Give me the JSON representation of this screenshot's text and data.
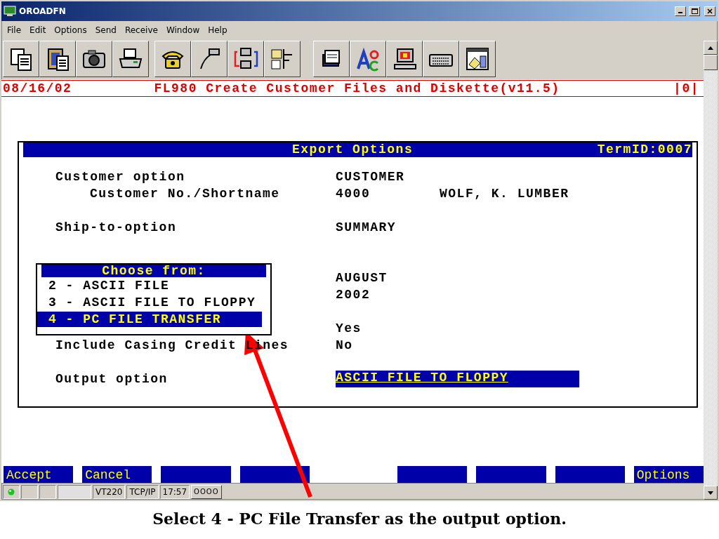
{
  "window": {
    "title": "OROADFN"
  },
  "menu": [
    "File",
    "Edit",
    "Options",
    "Send",
    "Receive",
    "Window",
    "Help"
  ],
  "terminal": {
    "date": "08/16/02",
    "title": "FL980 Create Customer Files and Diskette(v11.5)",
    "indicator": "|0|"
  },
  "dialog": {
    "title": "Export Options",
    "term_id": "TermID:0007",
    "fields": [
      {
        "kind": "field",
        "label": "Customer option",
        "value": "CUSTOMER",
        "children": [
          {
            "kind": "field",
            "label": "Customer No./Shortname",
            "value": "4000",
            "extra": "WOLF, K. LUMBER"
          }
        ]
      },
      {
        "kind": "spacer"
      },
      {
        "kind": "field",
        "label": "Ship-to-option",
        "value": "SUMMARY"
      },
      {
        "kind": "spacer"
      },
      {
        "kind": "spacer"
      },
      {
        "kind": "field",
        "value": "AUGUST"
      },
      {
        "kind": "field",
        "value": "2002"
      },
      {
        "kind": "spacer"
      },
      {
        "kind": "field",
        "value": "Yes"
      },
      {
        "kind": "field",
        "label": "Include Casing Credit Lines",
        "value": "No"
      },
      {
        "kind": "spacer"
      },
      {
        "kind": "input",
        "label": "Output option",
        "value": "ASCII FILE TO FLOPPY"
      }
    ]
  },
  "popup": {
    "title": "Choose from:",
    "options": [
      {
        "label": "2 - ASCII FILE",
        "selected": false
      },
      {
        "label": "3 - ASCII FILE TO FLOPPY",
        "selected": false
      },
      {
        "label": "4 - PC FILE TRANSFER",
        "selected": true
      }
    ]
  },
  "function_keys": [
    {
      "kind": "key",
      "label": "Accept"
    },
    {
      "kind": "key",
      "label": "Cancel"
    },
    {
      "kind": "key"
    },
    {
      "kind": "key"
    },
    {
      "kind": "space"
    },
    {
      "kind": "key"
    },
    {
      "kind": "key"
    },
    {
      "kind": "key"
    },
    {
      "kind": "key",
      "label": "Options"
    }
  ],
  "status_bar": {
    "connected": true,
    "panes": [
      "VT220",
      "TCP/IP",
      "17:57"
    ],
    "indicator": "OOOO"
  },
  "caption": "Select 4 - PC File Transfer as the output option."
}
